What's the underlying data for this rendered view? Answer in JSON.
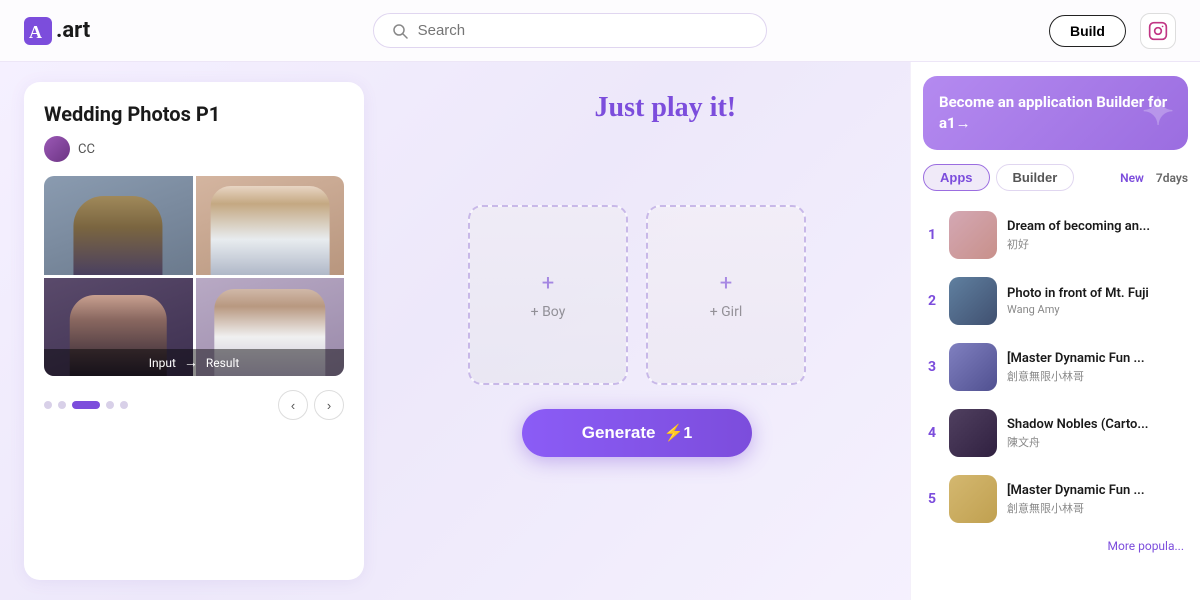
{
  "navbar": {
    "logo_text": ".art",
    "search_placeholder": "Search",
    "build_label": "Build",
    "instagram_icon": "instagram"
  },
  "left_card": {
    "title": "Wedding Photos P1",
    "author": "CC",
    "image_labels": [
      "Input",
      "→",
      "Result"
    ],
    "dots_count": 5,
    "active_dot": 3,
    "prev_label": "‹",
    "next_label": "›"
  },
  "just_play": {
    "text": "Just play it!",
    "arrow": "←"
  },
  "upload": {
    "boy_label": "+ Boy",
    "girl_label": "+ Girl"
  },
  "generate": {
    "label": "Generate",
    "cost": "⚡1"
  },
  "sidebar": {
    "promo_text": "Become an application Builder for a1→",
    "tabs": [
      "Apps",
      "Builder"
    ],
    "active_tab": "Apps",
    "time_options": [
      "New",
      "7days"
    ],
    "active_time": "New",
    "apps": [
      {
        "rank": "1",
        "name": "Dream of becoming an...",
        "sub": "初好",
        "thumb_class": "thumb-1"
      },
      {
        "rank": "2",
        "name": "Photo in front of Mt. Fuji",
        "sub": "Wang Amy",
        "thumb_class": "thumb-2"
      },
      {
        "rank": "3",
        "name": "[Master Dynamic Fun ...",
        "sub": "創意無限小林哥",
        "thumb_class": "thumb-3"
      },
      {
        "rank": "4",
        "name": "Shadow Nobles (Carto...",
        "sub": "陳文舟",
        "thumb_class": "thumb-4"
      },
      {
        "rank": "5",
        "name": "[Master Dynamic Fun ...",
        "sub": "創意無限小林哥",
        "thumb_class": "thumb-5"
      }
    ],
    "more_label": "More popula..."
  }
}
